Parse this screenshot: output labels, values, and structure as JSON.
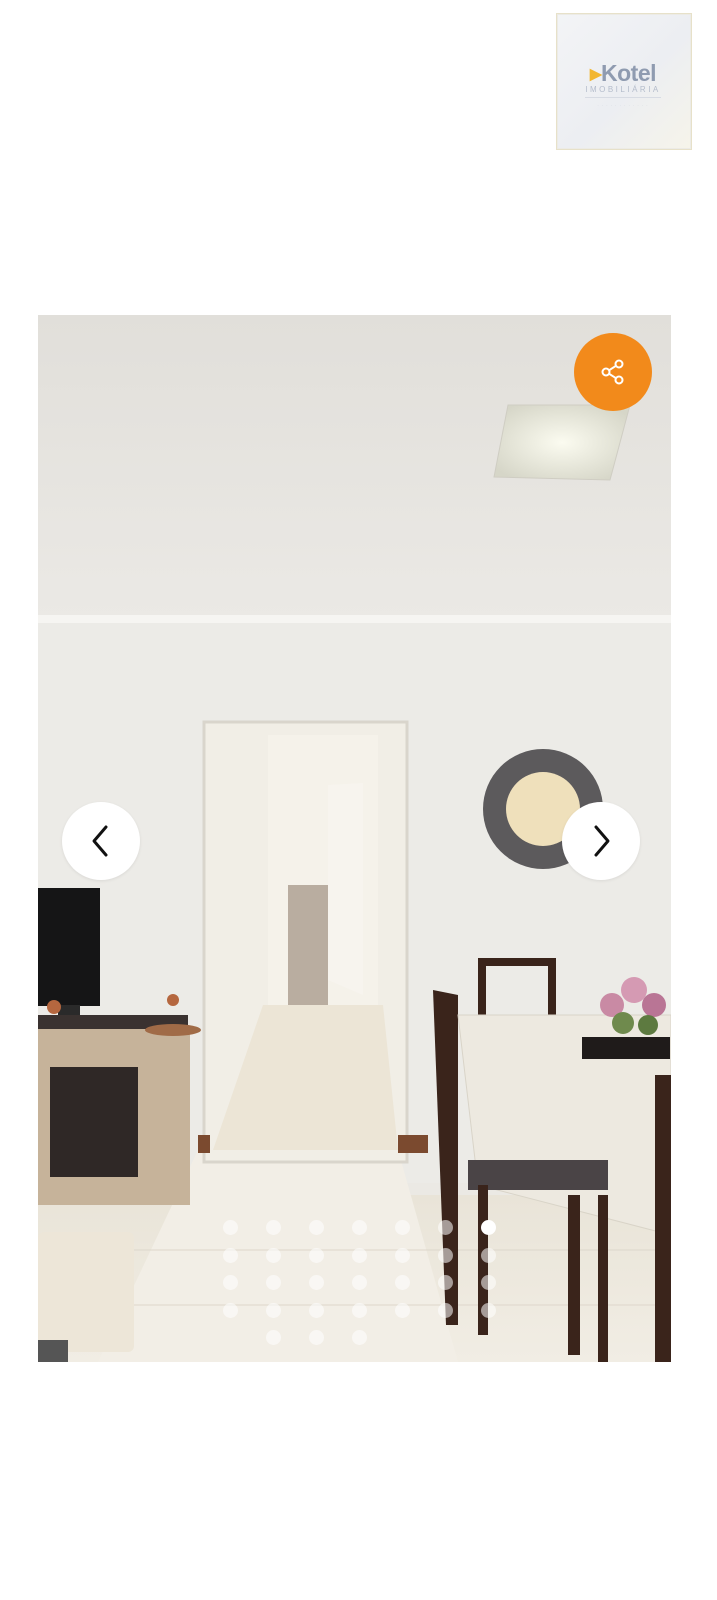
{
  "logo": {
    "brand": "Kotel",
    "subtitle": "IMOBILIÁRIA"
  },
  "gallery": {
    "share_icon": "share-icon",
    "prev_icon": "chevron-left-icon",
    "next_icon": "chevron-right-icon",
    "photo_count": 31,
    "active_index": 6
  },
  "colors": {
    "accent": "#f28a1b",
    "logo_text": "#8f9bb0",
    "logo_mark": "#f2b630"
  }
}
